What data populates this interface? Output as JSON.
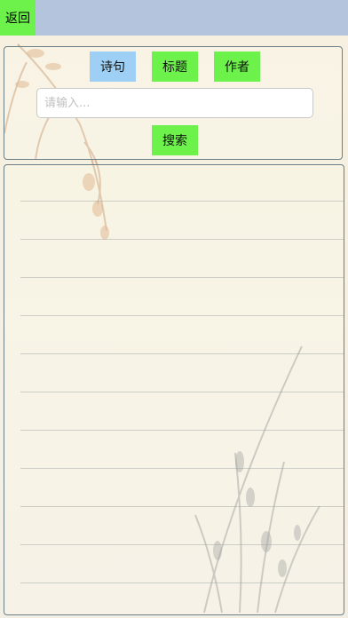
{
  "header": {
    "back_label": "返回"
  },
  "search": {
    "modes": [
      "诗句",
      "标题",
      "作者"
    ],
    "selected_mode": "诗句",
    "placeholder": "请输入...",
    "value": "",
    "submit_label": "搜索"
  },
  "results": {
    "rows": [
      "",
      "",
      "",
      "",
      "",
      "",
      "",
      "",
      "",
      "",
      "",
      ""
    ]
  },
  "colors": {
    "topbar": "#b3c4dc",
    "button_green": "#6cf24b",
    "button_selected": "#9dd0f4",
    "card_border": "#6a7f86"
  }
}
